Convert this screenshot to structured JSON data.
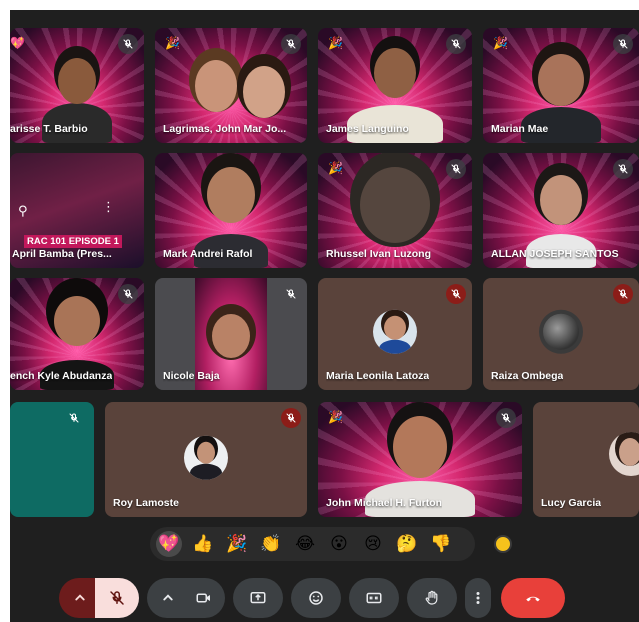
{
  "participants": {
    "p1": {
      "name": "arisse T. Barbio"
    },
    "p2": {
      "name": "Lagrimas, John Mar Jo..."
    },
    "p3": {
      "name": "James Languino"
    },
    "p4": {
      "name": "Marian Mae"
    },
    "p5": {
      "name": "April Bamba (Pres...",
      "slide_text": "RAC 101 EPISODE 1"
    },
    "p6": {
      "name": "Mark Andrei Rafol"
    },
    "p7": {
      "name": "Rhussel Ivan Luzong"
    },
    "p8": {
      "name": "ALLAN JOSEPH SANTOS"
    },
    "p9": {
      "name": "ench Kyle Abudanza"
    },
    "p10": {
      "name": "Nicole Baja"
    },
    "p11": {
      "name": "Maria Leonila Latoza"
    },
    "p12": {
      "name": "Raiza Ombega"
    },
    "p13": {
      "name": ""
    },
    "p14": {
      "name": "Roy Lamoste"
    },
    "p15": {
      "name": "John Michael H. Furton"
    },
    "p16": {
      "name": "Lucy Garcia"
    }
  },
  "reactions": [
    "💖",
    "👍",
    "🎉",
    "👏",
    "😂",
    "😮",
    "😢",
    "🤔",
    "👎"
  ],
  "tile_emojis": {
    "heart": "💖",
    "party": "🎉"
  },
  "controls": {
    "expand_audio": "chevron-up-icon",
    "mic": "mic-off-icon",
    "expand_video": "chevron-up-icon",
    "camera": "camera-icon",
    "present": "present-screen-icon",
    "emoji": "emoji-icon",
    "captions": "captions-icon",
    "hand": "raise-hand-icon",
    "more": "more-vert-icon",
    "leave": "end-call-icon"
  },
  "colors": {
    "leave": "#e8403a",
    "mic_muted": "#f9dedc",
    "stage_bg": "#1f1f1f"
  }
}
